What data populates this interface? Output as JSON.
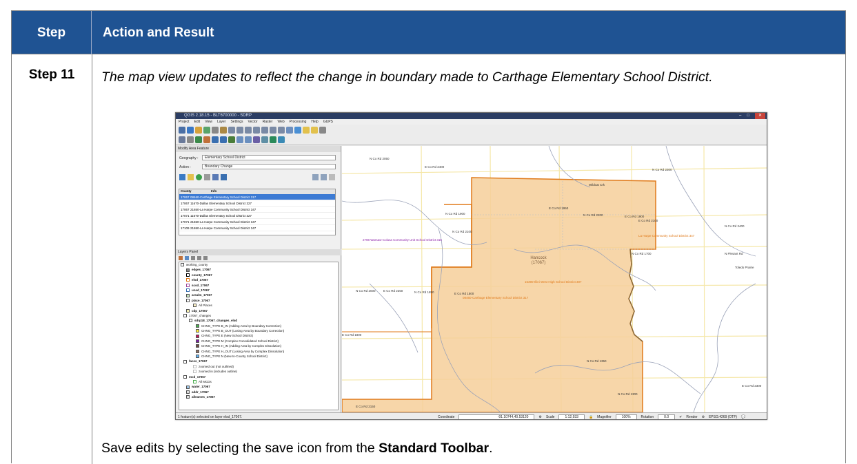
{
  "table": {
    "header": {
      "step": "Step",
      "action": "Action and Result"
    },
    "row": {
      "step": "Step 11",
      "description": "The map view updates to reflect the change in boundary made to Carthage Elementary School District.",
      "save_prefix": "Save edits by selecting the save icon from the ",
      "save_bold": "Standard Toolbar",
      "save_suffix": "."
    }
  },
  "screenshot": {
    "window_title": "QGIS 2.18.15 - BLT6700000 - SDRP",
    "menu": [
      "Project",
      "Edit",
      "View",
      "Layer",
      "Settings",
      "Vector",
      "Raster",
      "Web",
      "Processing",
      "Help",
      "GUPS"
    ],
    "modify_panel": {
      "title": "Modify Area Feature",
      "geography_label": "Geography :",
      "geography_value": "Elementary School District",
      "action_label": "Action :",
      "action_value": "Boundary Change",
      "columns": [
        "County",
        "Info"
      ],
      "rows": [
        {
          "county": "17067",
          "info": "08460-Carthage Elementary School District 317"
        },
        {
          "county": "17067",
          "info": "11670-Dallas Elementary School District 327"
        },
        {
          "county": "17067",
          "info": "21650-La Harpe Community School District 347"
        },
        {
          "county": "17071",
          "info": "11670-Dallas Elementary School District 327"
        },
        {
          "county": "17071",
          "info": "21650-La Harpe Community School District 347"
        },
        {
          "county": "17109",
          "info": "21650-La Harpe Community School District 347"
        }
      ]
    },
    "layers_panel": {
      "title": "Layers Panel",
      "items": [
        "working_county",
        "edges_17067",
        "county_17067",
        "elsd_17067",
        "scsd_17067",
        "unsd_17067",
        "arealm_17067",
        "place_17067",
        "All Places",
        "cdp_17067",
        "17067_changes",
        "sdrp18_17067_changes_elsd",
        "CHNG_TYPE B_IN (Adding Area by Boundary Correction)",
        "CHNG_TYPE B_OUT (Losing Area by Boundary Correction)",
        "CHNG_TYPE E (New School District)",
        "CHNG_TYPE M (Complex Consolidated School District)",
        "CHNG_TYPE H_IN (Adding Area by Complex Dissolution)",
        "CHNG_TYPE H_OUT (Losing Area by Complex Dissolution)",
        "CHNG_TYPE N (New In-County School District)",
        "faces_17067",
        "zoomed out (not outlined)",
        "zoomed in (includes outline)",
        "mcd_17067",
        "All MCDs",
        "water_17067",
        "addr_17067",
        "alleames_17067"
      ]
    },
    "map_labels": {
      "county": "Hancock",
      "county_code": "(17067)",
      "carthage": "08460-Carthage Elementary School District 317",
      "warsaw": "2798 Warsaw-Colusa Community Unit School District 316",
      "west_high": "15390-Illini West High School District 307",
      "laharpe": "La Harpe Community School District 347",
      "wildcat": "Wildcat Crk",
      "roads": [
        "N Co Rd 2050",
        "E Co Rd 2400",
        "N Co Rd 2300",
        "E Co Rd 1950",
        "N Co Rd 2200",
        "N Co Rd 1900",
        "E Co Rd 1900",
        "N Co Rd 2400",
        "N Co Rd 2000",
        "E Co Rd 2250",
        "N Co Rd 1850",
        "E Co Rd 1500",
        "N Co Rd 1350",
        "E Co Rd 2100",
        "N Co Rd 2100",
        "N Co Rd 1700",
        "N Co Rd 1300",
        "E Co Rd 2150",
        "E Co Rd 1800",
        "E Co Rd 2300"
      ],
      "toledo": "Toledo Prairie",
      "niota": "N Plesant Rd"
    },
    "status": {
      "selection": "1 feature(s) selected on layer elsd_17067.",
      "coordinate_label": "Coordinate",
      "coordinate": "-91.10744,40.53120",
      "scale_label": "Scale",
      "scale": "1:12,933",
      "magnifier_label": "Magnifier",
      "magnifier": "100%",
      "rotation_label": "Rotation",
      "rotation": "0.0",
      "render": "Render",
      "crs": "EPSG:4269 (OTF)"
    }
  }
}
